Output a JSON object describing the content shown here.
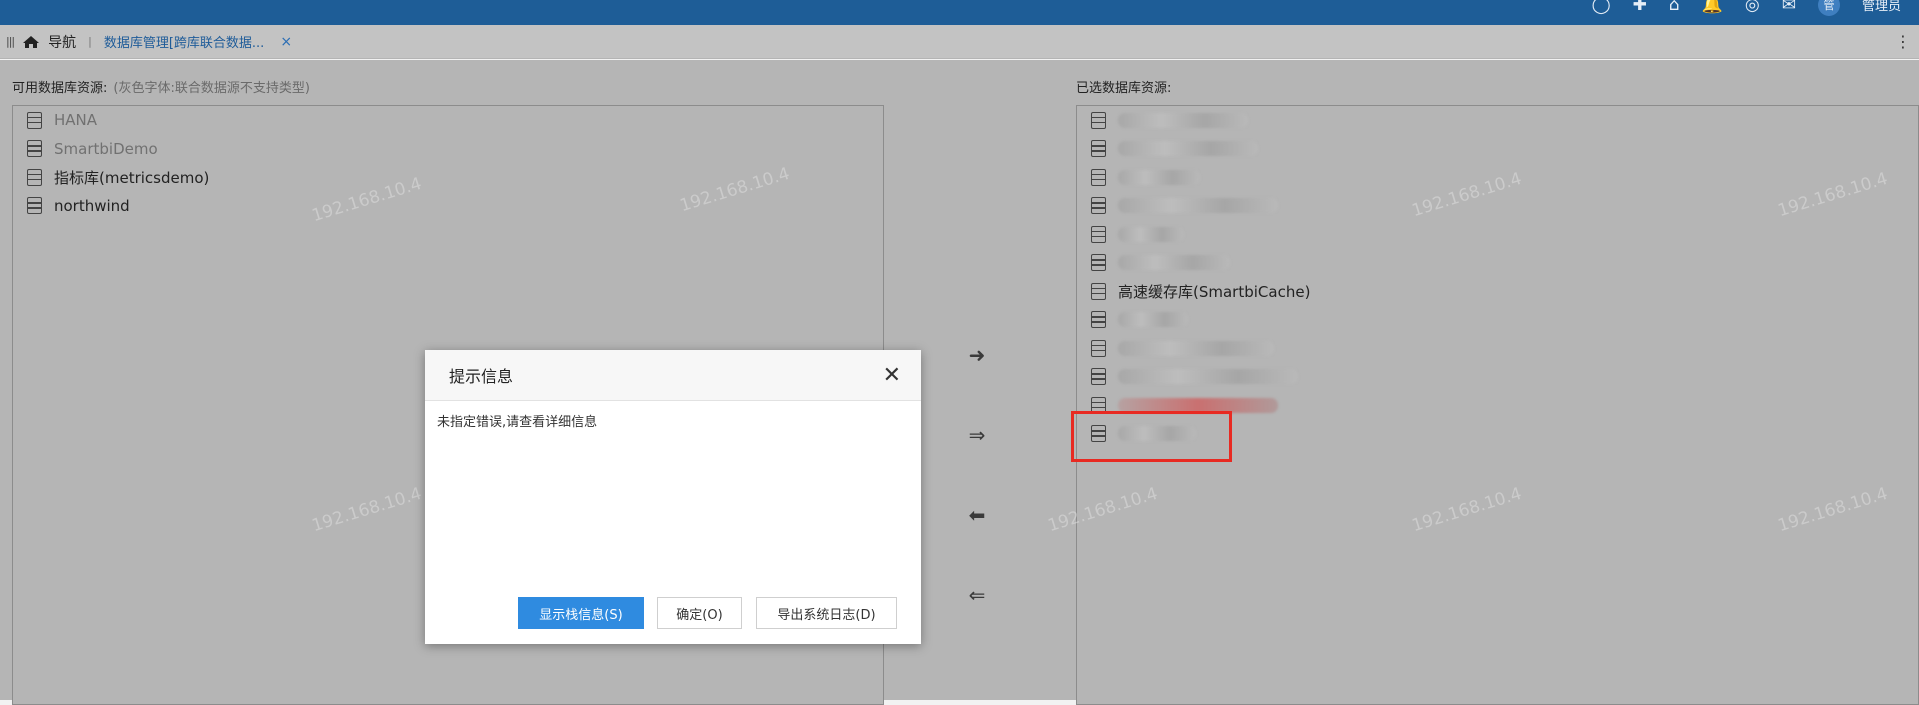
{
  "topbar": {
    "icons": [
      "search-icon",
      "plus-icon",
      "home-icon",
      "bell-icon",
      "compass-icon",
      "chat-icon"
    ],
    "avatar_text": "管",
    "user_label": "管理员",
    "color": "#1e5d97"
  },
  "tabbar": {
    "nav_label": "导航",
    "separator": "|",
    "active_tab": "数据库管理[跨库联合数据...",
    "close_glyph": "×"
  },
  "left": {
    "label": "可用数据库资源:",
    "hint": "(灰色字体:联合数据源不支持类型)",
    "items": [
      {
        "text": "HANA",
        "disabled": true
      },
      {
        "text": "SmartbiDemo",
        "disabled": true
      },
      {
        "text": "指标库(metricsdemo)",
        "disabled": false
      },
      {
        "text": "northwind",
        "disabled": false
      }
    ]
  },
  "right": {
    "label": "已选数据库资源:",
    "visible_item": "高速缓存库(SmartbiCache)",
    "highlight_color": "#e82a22"
  },
  "watermark": "192.168.10.4",
  "dialog": {
    "title": "提示信息",
    "message": "未指定错误,请查看详细信息",
    "buttons": {
      "stack": "显示栈信息(S)",
      "ok": "确定(O)",
      "export_log": "导出系统日志(D)"
    },
    "primary_color": "#2f8be0"
  }
}
